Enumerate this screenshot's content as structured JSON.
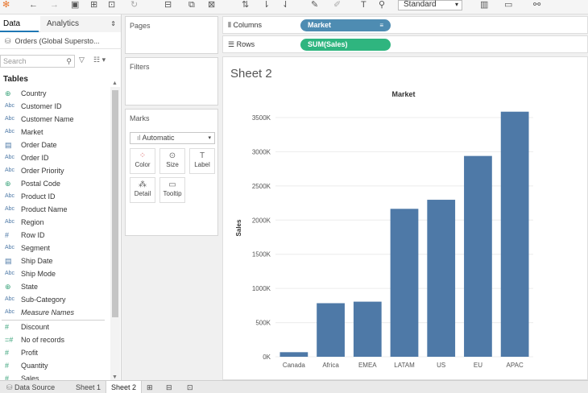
{
  "toolbar": {
    "view_size": "Standard"
  },
  "data_pane": {
    "tabs": [
      "Data",
      "Analytics"
    ],
    "datasource": "Orders (Global Supersto...",
    "search_placeholder": "Search",
    "tables_header": "Tables",
    "fields": [
      {
        "icon": "globe",
        "name": "Country"
      },
      {
        "icon": "Abc",
        "name": "Customer ID"
      },
      {
        "icon": "Abc",
        "name": "Customer Name"
      },
      {
        "icon": "Abc",
        "name": "Market"
      },
      {
        "icon": "calendar",
        "name": "Order Date"
      },
      {
        "icon": "Abc",
        "name": "Order ID"
      },
      {
        "icon": "Abc",
        "name": "Order Priority"
      },
      {
        "icon": "globe",
        "name": "Postal Code"
      },
      {
        "icon": "Abc",
        "name": "Product ID"
      },
      {
        "icon": "Abc",
        "name": "Product Name"
      },
      {
        "icon": "Abc",
        "name": "Region"
      },
      {
        "icon": "#",
        "name": "Row ID"
      },
      {
        "icon": "Abc",
        "name": "Segment"
      },
      {
        "icon": "calendar",
        "name": "Ship Date"
      },
      {
        "icon": "Abc",
        "name": "Ship Mode"
      },
      {
        "icon": "globe",
        "name": "State"
      },
      {
        "icon": "Abc",
        "name": "Sub-Category"
      },
      {
        "icon": "Abc",
        "name": "Measure Names"
      },
      {
        "icon": "#",
        "name": "Discount"
      },
      {
        "icon": "=#",
        "name": "No of records"
      },
      {
        "icon": "#",
        "name": "Profit"
      },
      {
        "icon": "#",
        "name": "Quantity"
      },
      {
        "icon": "#",
        "name": "Sales"
      }
    ]
  },
  "cards": {
    "pages": "Pages",
    "filters": "Filters",
    "marks": "Marks",
    "mark_type": "Automatic",
    "mark_buttons": [
      "Color",
      "Size",
      "Label",
      "Detail",
      "Tooltip"
    ]
  },
  "shelves": {
    "columns_label": "Columns",
    "rows_label": "Rows",
    "columns_pill": "Market",
    "rows_pill": "SUM(Sales)"
  },
  "sheet": {
    "title": "Sheet 2"
  },
  "chart_data": {
    "type": "bar",
    "title": "Market",
    "ylabel": "Sales",
    "xlabel": "",
    "categories": [
      "Canada",
      "Africa",
      "EMEA",
      "LATAM",
      "US",
      "EU",
      "APAC"
    ],
    "values": [
      66929,
      783773,
      806162,
      2164605,
      2297201,
      2938089,
      3585745
    ],
    "ylim": [
      0,
      3700000
    ],
    "yticks": [
      0,
      500000,
      1000000,
      1500000,
      2000000,
      2500000,
      3000000,
      3500000
    ],
    "ytick_labels": [
      "0K",
      "500K",
      "1000K",
      "1500K",
      "2000K",
      "2500K",
      "3000K",
      "3500K"
    ],
    "grid": true,
    "bar_color": "#4e79a7"
  },
  "bottom_tabs": [
    "Data Source",
    "Sheet 1",
    "Sheet 2"
  ]
}
